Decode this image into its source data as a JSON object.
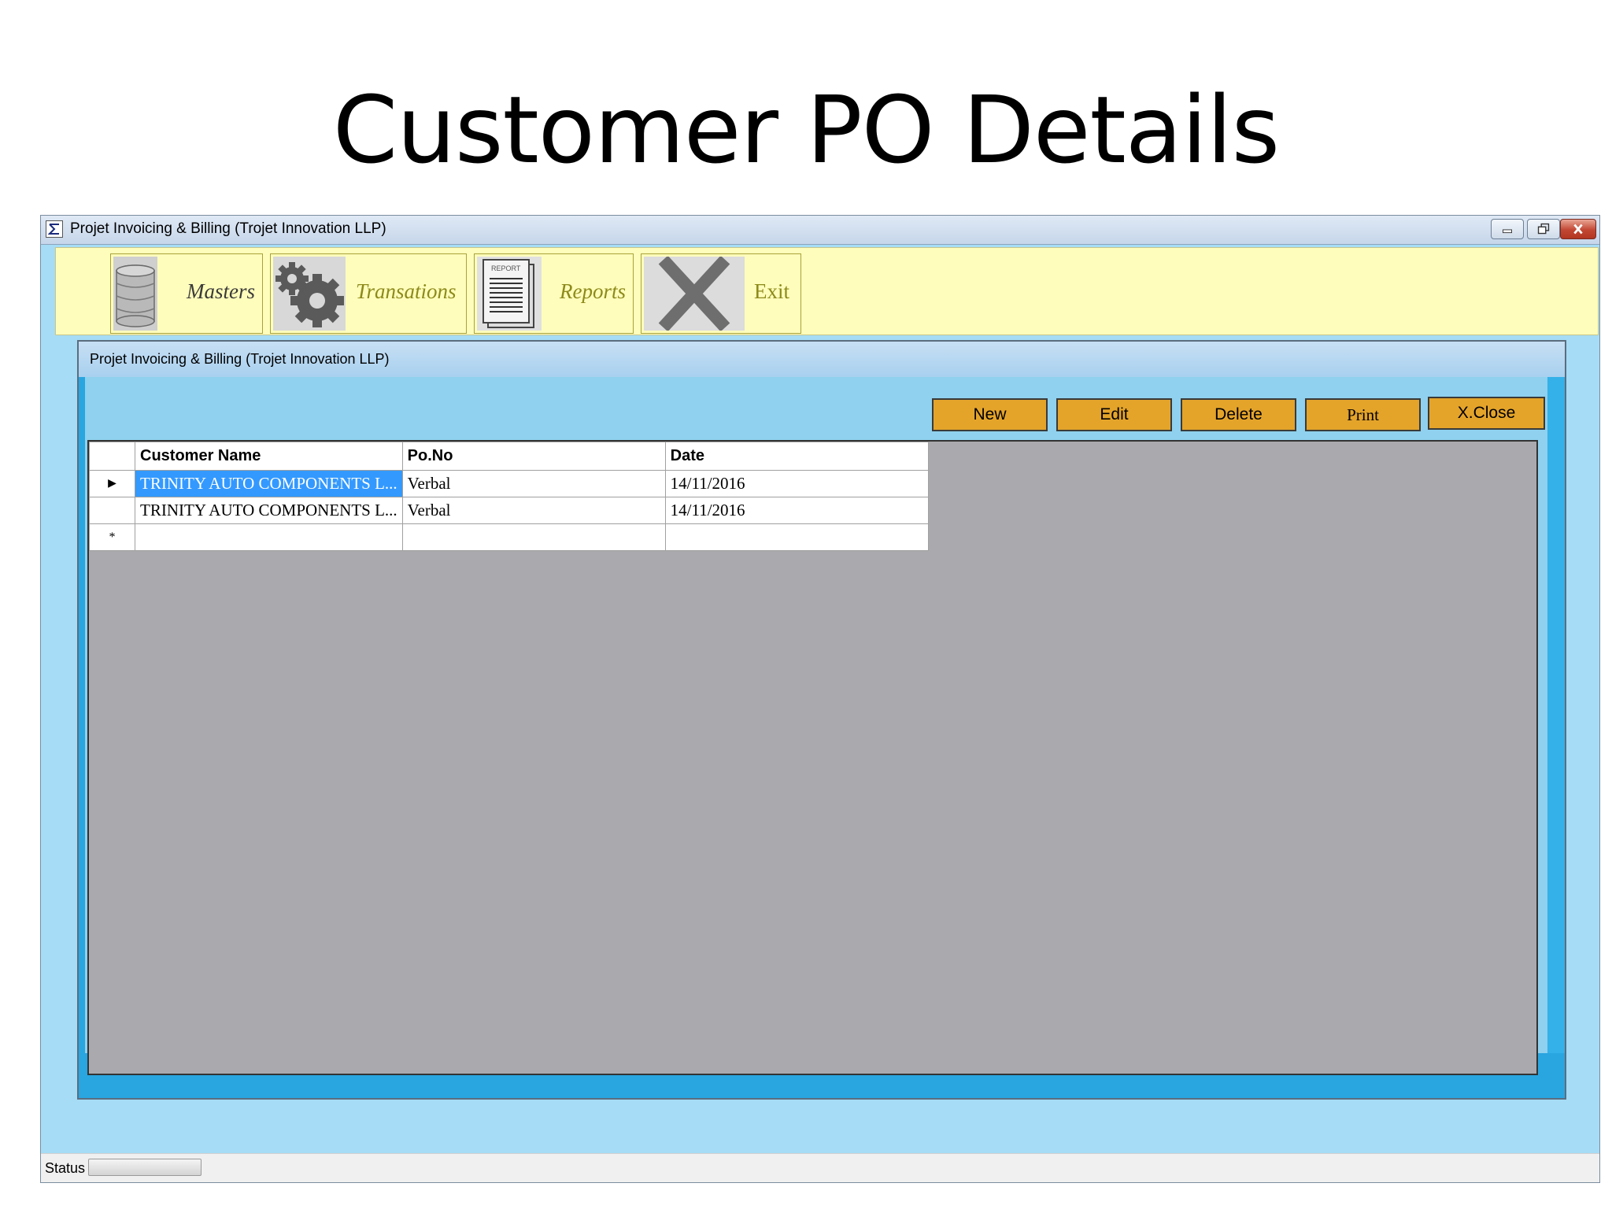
{
  "slide": {
    "title": "Customer PO Details"
  },
  "window": {
    "title": "Projet Invoicing & Billing (Trojet Innovation LLP)"
  },
  "toolbar": {
    "masters_label": "Masters",
    "transactions_label": "Transations",
    "reports_label": "Reports",
    "report_icon_caption": "REPORT",
    "exit_label": "Exit"
  },
  "mdi": {
    "title": "Projet Invoicing & Billing (Trojet Innovation LLP)",
    "actions": {
      "new": "New",
      "edit": "Edit",
      "delete": "Delete",
      "print": "Print",
      "close": "X.Close"
    }
  },
  "grid": {
    "columns": [
      "Customer Name",
      "Po.No",
      "Date"
    ],
    "rows": [
      {
        "indicator": "▶",
        "customer": "TRINITY AUTO COMPONENTS L...",
        "po": "Verbal",
        "date": "14/11/2016"
      },
      {
        "indicator": "",
        "customer": "TRINITY AUTO COMPONENTS L...",
        "po": "Verbal",
        "date": "14/11/2016"
      }
    ],
    "new_row_indicator": "*"
  },
  "statusbar": {
    "label": "Status"
  },
  "colors": {
    "toolbar_bg": "#fffdbb",
    "action_button": "#e4a42a",
    "selection": "#3399ff",
    "grid_bg": "#aaa9ad"
  }
}
